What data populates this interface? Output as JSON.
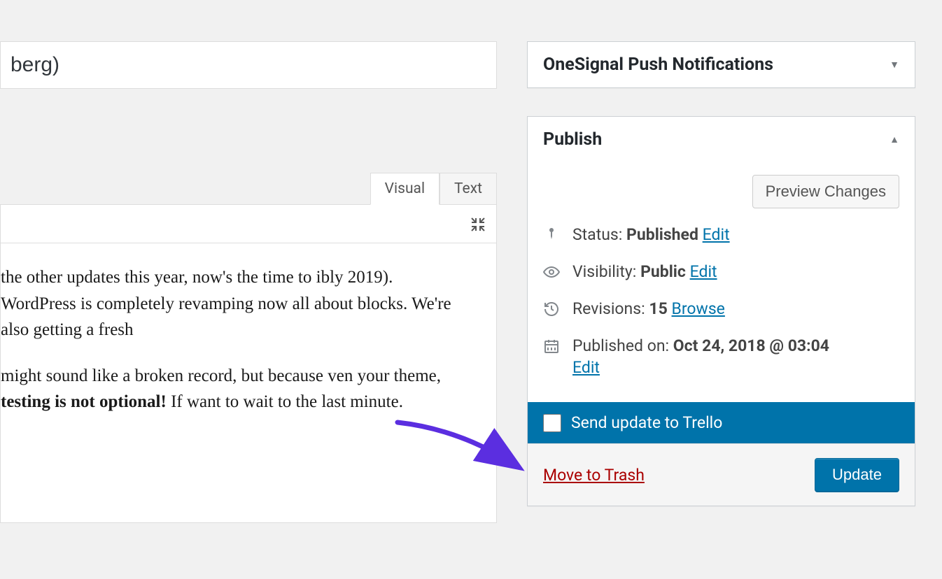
{
  "title_fragment": "berg)",
  "editor": {
    "tabs": {
      "visual": "Visual",
      "text": "Text"
    },
    "active_tab": "visual",
    "paragraphs": [
      {
        "pre": " the other updates this year, now's the time to ibly 2019). WordPress is completely revamping now all about blocks. We're also getting a fresh"
      },
      {
        "pre": "might sound like a broken record, but because ven your theme, ",
        "strong": "testing is not optional!",
        "post": " If want to wait to the last minute."
      }
    ]
  },
  "sidebar": {
    "onesignal": {
      "title": "OneSignal Push Notifications"
    },
    "publish": {
      "title": "Publish",
      "preview": "Preview Changes",
      "status_label": "Status: ",
      "status_value": "Published",
      "status_edit": "Edit",
      "visibility_label": "Visibility: ",
      "visibility_value": "Public",
      "visibility_edit": "Edit",
      "revisions_label": "Revisions: ",
      "revisions_value": "15",
      "revisions_browse": "Browse",
      "published_label": "Published on: ",
      "published_value": "Oct 24, 2018 @ 03:04",
      "published_edit": "Edit",
      "trello_label": "Send update to Trello",
      "trash": "Move to Trash",
      "update": "Update"
    }
  }
}
